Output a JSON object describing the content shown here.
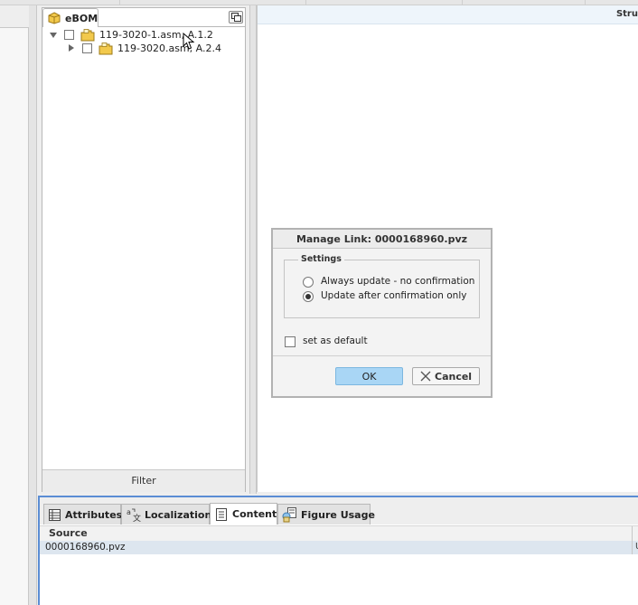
{
  "tree": {
    "tab_label": "eBOM",
    "nodes": [
      {
        "label": "119-3020-1.asm, A.1.2"
      },
      {
        "label": "119-3020.asm, A.2.4"
      }
    ],
    "filter_label": "Filter"
  },
  "main": {
    "header_label": "Stru"
  },
  "dialog": {
    "title": "Manage Link: 0000168960.pvz",
    "group_label": "Settings",
    "options": [
      {
        "label": "Always update - no confirmation",
        "selected": false
      },
      {
        "label": "Update after confirmation only",
        "selected": true
      }
    ],
    "default_label": "set as default",
    "ok_label": "OK",
    "cancel_label": "Cancel"
  },
  "bottom": {
    "tabs": [
      {
        "label": "Attributes"
      },
      {
        "label": "Localization"
      },
      {
        "label": "Content",
        "active": true
      },
      {
        "label": "Figure Usage"
      }
    ],
    "column_header": "Source",
    "rows": [
      {
        "source": "0000168960.pvz",
        "edge": "U"
      }
    ]
  }
}
